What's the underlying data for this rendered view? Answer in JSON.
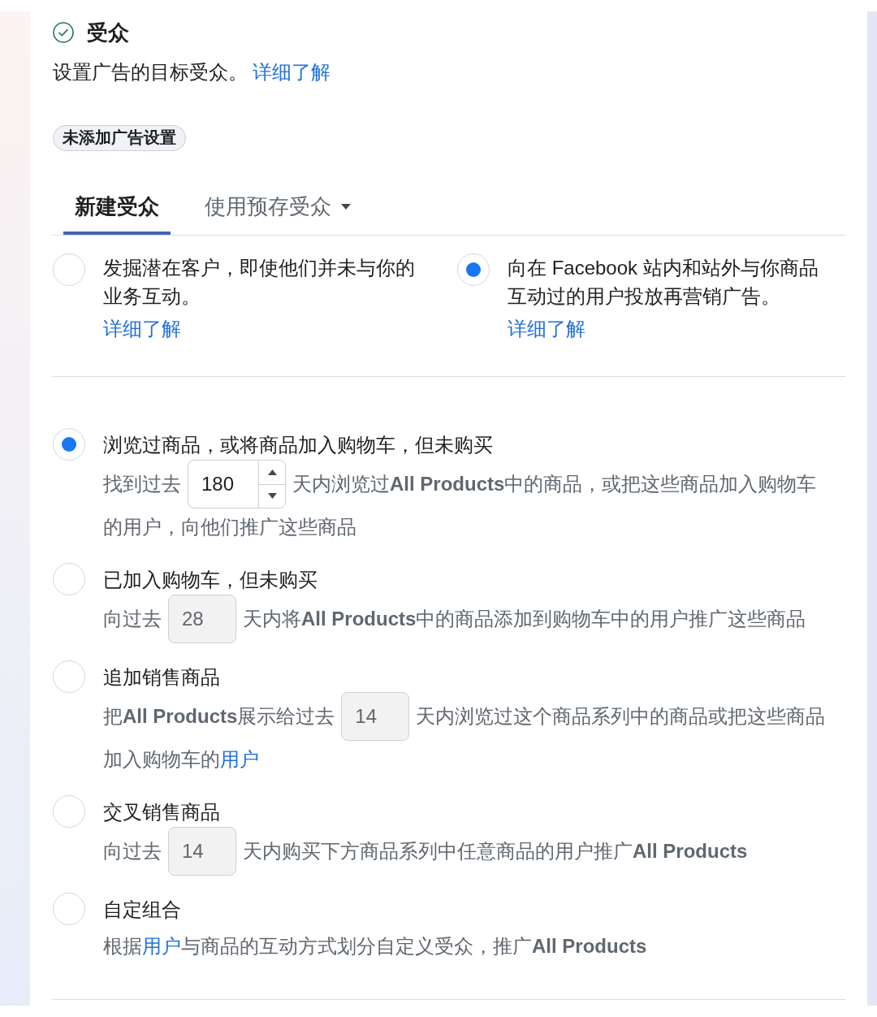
{
  "header": {
    "title": "受众",
    "complete": true,
    "description": "设置广告的目标受众。",
    "description_link": "详细了解",
    "badge": "未添加广告设置"
  },
  "tabs": [
    {
      "label": "新建受众",
      "selected": true,
      "dropdown": false
    },
    {
      "label": "使用预存受众",
      "selected": false,
      "dropdown": true
    }
  ],
  "audience_types": [
    {
      "text": "发掘潜在客户，即使他们并未与你的业务互动。",
      "link": "详细了解",
      "selected": false
    },
    {
      "text": "向在 Facebook 站内和站外与你商品互动过的用户投放再营销广告。",
      "link": "详细了解",
      "selected": true
    }
  ],
  "retargeting_options": [
    {
      "title": "浏览过商品，或将商品加入购物车，但未购买",
      "selected": true,
      "lines": [
        [
          {
            "kind": "text",
            "text": "找到过去"
          },
          {
            "kind": "days_field",
            "value": "180",
            "disabled": false
          },
          {
            "kind": "text",
            "text": "天内浏览过**All Products**中的商品，或把这些商品加入购物车"
          }
        ],
        [
          {
            "kind": "text",
            "text": "的用户，向他们推广这些商品"
          }
        ]
      ]
    },
    {
      "title": "已加入购物车，但未购买",
      "selected": false,
      "lines": [
        [
          {
            "kind": "text",
            "text": "向过去"
          },
          {
            "kind": "days_field",
            "value": "28",
            "disabled": true
          },
          {
            "kind": "text",
            "text": "天内将**All Products**中的商品添加到购物车中的用户推广这些商品"
          }
        ]
      ]
    },
    {
      "title": "追加销售商品",
      "selected": false,
      "lines": [
        [
          {
            "kind": "text",
            "text": "把**All Products**展示给过去"
          },
          {
            "kind": "days_field",
            "value": "14",
            "disabled": true
          },
          {
            "kind": "text",
            "text": "天内浏览过这个商品系列中的商品或把这些商品"
          }
        ],
        [
          {
            "kind": "text",
            "text": "加入购物车的"
          },
          {
            "kind": "link",
            "text": "用户"
          }
        ]
      ]
    },
    {
      "title": "交叉销售商品",
      "selected": false,
      "lines": [
        [
          {
            "kind": "text",
            "text": "向过去"
          },
          {
            "kind": "days_field",
            "value": "14",
            "disabled": true
          },
          {
            "kind": "text",
            "text": "天内购买下方商品系列中任意商品的用户推广**All Products**"
          }
        ]
      ]
    },
    {
      "title": "自定组合",
      "selected": false,
      "lines": [
        [
          {
            "kind": "text",
            "text": "根据"
          },
          {
            "kind": "link",
            "text": "用户"
          },
          {
            "kind": "text",
            "text": "与商品的互动方式划分自定义受众，推广**All Products**"
          }
        ]
      ]
    }
  ]
}
